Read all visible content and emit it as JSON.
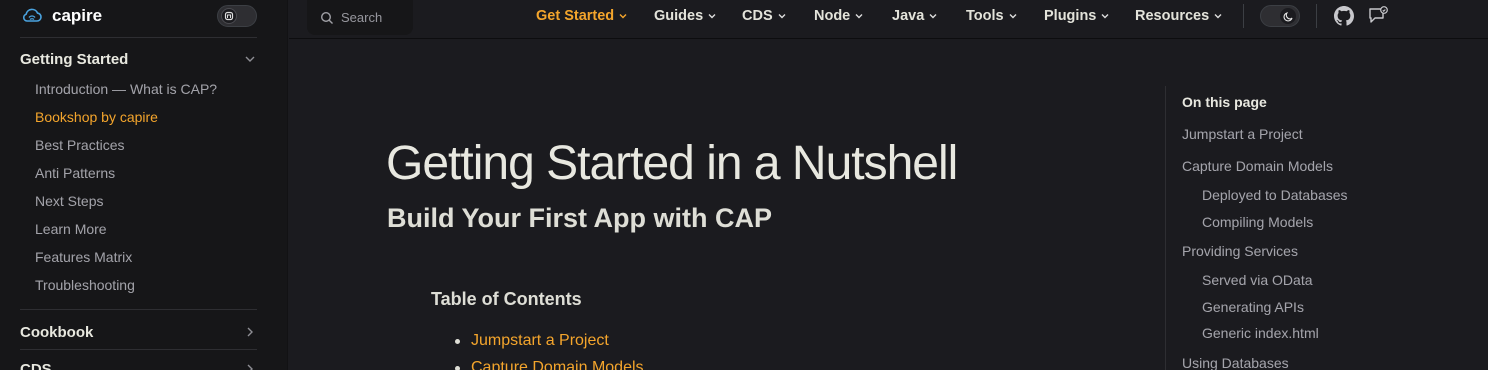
{
  "brand": {
    "name": "capire"
  },
  "search": {
    "label": "Search"
  },
  "nav": [
    {
      "label": "Get Started",
      "active": true
    },
    {
      "label": "Guides"
    },
    {
      "label": "CDS"
    },
    {
      "label": "Node"
    },
    {
      "label": "Java"
    },
    {
      "label": "Tools"
    },
    {
      "label": "Plugins"
    },
    {
      "label": "Resources"
    }
  ],
  "sidebar": {
    "groups": [
      {
        "label": "Getting Started",
        "expanded": true,
        "items": [
          "Introduction — What is CAP?",
          "Bookshop by capire",
          "Best Practices",
          "Anti Patterns",
          "Next Steps",
          "Learn More",
          "Features Matrix",
          "Troubleshooting"
        ],
        "active_index": 1
      },
      {
        "label": "Cookbook",
        "expanded": false
      },
      {
        "label": "CDS",
        "expanded": false
      }
    ]
  },
  "main": {
    "title": "Getting Started in a Nutshell",
    "subtitle": "Build Your First App with CAP",
    "toc_title": "Table of Contents",
    "toc_items": [
      "Jumpstart a Project",
      "Capture Domain Models"
    ]
  },
  "outline": {
    "title": "On this page",
    "items": [
      {
        "label": "Jumpstart a Project",
        "level": 1
      },
      {
        "label": "Capture Domain Models",
        "level": 1
      },
      {
        "label": "Deployed to Databases",
        "level": 2
      },
      {
        "label": "Compiling Models",
        "level": 2
      },
      {
        "label": "Providing Services",
        "level": 1
      },
      {
        "label": "Served via OData",
        "level": 2
      },
      {
        "label": "Generating APIs",
        "level": 2
      },
      {
        "label": "Generic index.html",
        "level": 2
      },
      {
        "label": "Using Databases",
        "level": 1
      }
    ]
  },
  "colors": {
    "accent": "#f4a52c",
    "background": "#1b1b1f",
    "sidebar": "#161618"
  },
  "icons": [
    "cloud-logo-icon",
    "theme-toggle-icon",
    "search-icon",
    "chevron-down-icon",
    "chevron-right-icon",
    "moon-icon",
    "github-icon",
    "feedback-icon"
  ]
}
